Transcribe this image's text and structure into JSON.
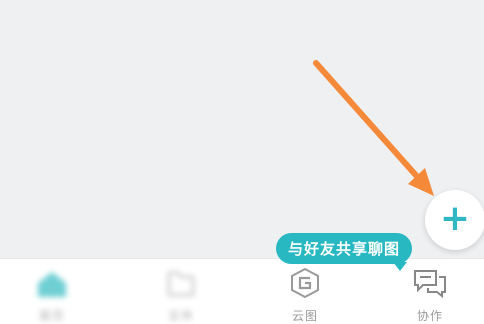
{
  "tabs": {
    "home_label": "首页",
    "files_label": "文件",
    "cloud_label": "云图",
    "collab_label": "协作"
  },
  "tooltip": {
    "text": "与好友共享聊图"
  },
  "fab": {
    "symbol": "+"
  },
  "icons": {
    "fab": "plus-icon",
    "home": "home-icon",
    "files": "folder-icon",
    "cloud": "cloud-g-icon",
    "collab": "chat-bubbles-icon"
  },
  "colors": {
    "accent": "#2fb8c4",
    "tooltip_bg": "#28b8c2",
    "annotation_arrow": "#f5893a",
    "tab_label": "#9a9a9a",
    "background": "#eff0f2"
  }
}
